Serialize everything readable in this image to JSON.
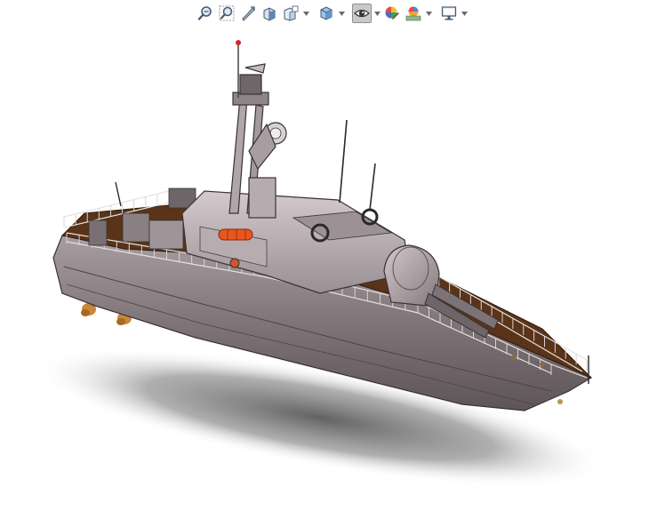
{
  "toolbar": {
    "buttons": [
      {
        "name": "zoom-to-fit-icon",
        "dropdown": false,
        "active": false
      },
      {
        "name": "zoom-to-area-icon",
        "dropdown": false,
        "active": false
      },
      {
        "name": "previous-view-icon",
        "dropdown": false,
        "active": false
      },
      {
        "name": "section-view-icon",
        "dropdown": false,
        "active": false
      },
      {
        "name": "view-orientation-icon",
        "dropdown": true,
        "active": false
      },
      {
        "name": "display-style-icon",
        "dropdown": true,
        "active": false
      },
      {
        "name": "hide-show-items-icon",
        "dropdown": true,
        "active": true
      },
      {
        "name": "edit-appearance-icon",
        "dropdown": false,
        "active": false
      },
      {
        "name": "apply-scene-icon",
        "dropdown": true,
        "active": false
      },
      {
        "name": "view-settings-icon",
        "dropdown": true,
        "active": false
      }
    ]
  },
  "viewport": {
    "model": "patrol-boat-3d-model",
    "colors": {
      "hull": "#7d7377",
      "hull_light": "#b9aeb2",
      "deck": "#5a3418",
      "superstructure": "#c4b9bd",
      "accent_orange": "#e8571e",
      "mast_light": "#e02020",
      "shadow": "#6a6a6a"
    }
  }
}
